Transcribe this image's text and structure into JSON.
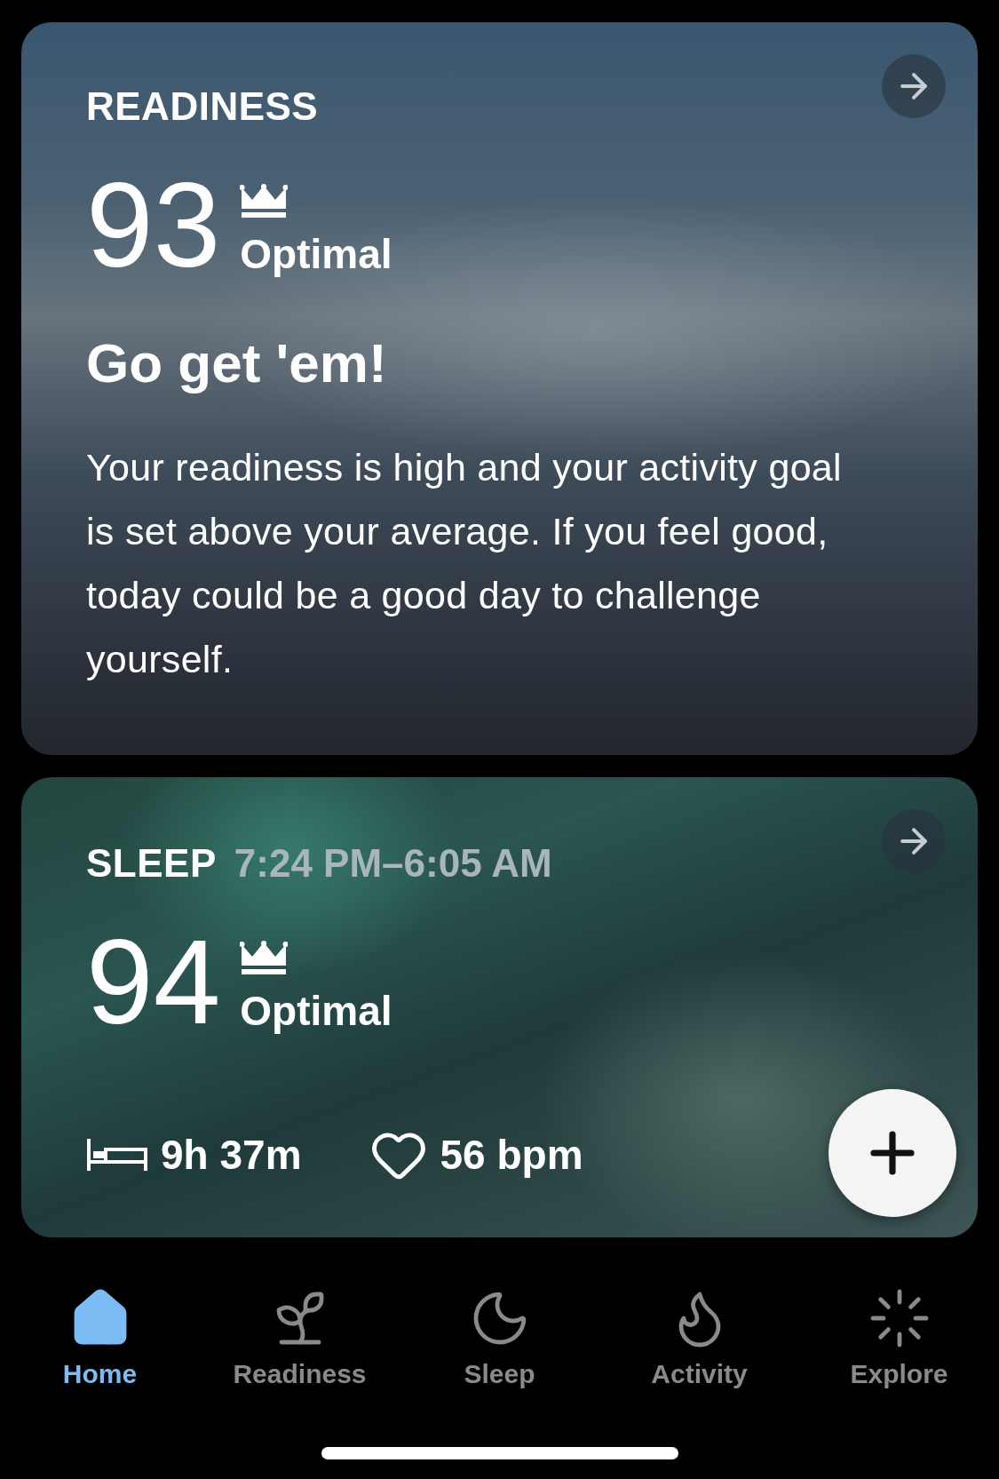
{
  "cards": [
    {
      "kind": "readiness",
      "title": "READINESS",
      "score": "93",
      "rating": "Optimal",
      "headline": "Go get 'em!",
      "body": "Your readiness is high and your activity goal is set above your average. If you feel good, today could be a good day to challenge yourself."
    },
    {
      "kind": "sleep",
      "title": "SLEEP",
      "time_range": "7:24 PM–6:05 AM",
      "score": "94",
      "rating": "Optimal",
      "stats": [
        {
          "kind": "duration",
          "value": "9h 37m"
        },
        {
          "kind": "heart_rate",
          "value": "56 bpm"
        }
      ]
    }
  ],
  "nav": [
    {
      "kind": "home",
      "label": "Home",
      "selected": true
    },
    {
      "kind": "readiness",
      "label": "Readiness",
      "selected": false
    },
    {
      "kind": "sleep",
      "label": "Sleep",
      "selected": false
    },
    {
      "kind": "activity",
      "label": "Activity",
      "selected": false
    },
    {
      "kind": "explore",
      "label": "Explore",
      "selected": false
    }
  ]
}
